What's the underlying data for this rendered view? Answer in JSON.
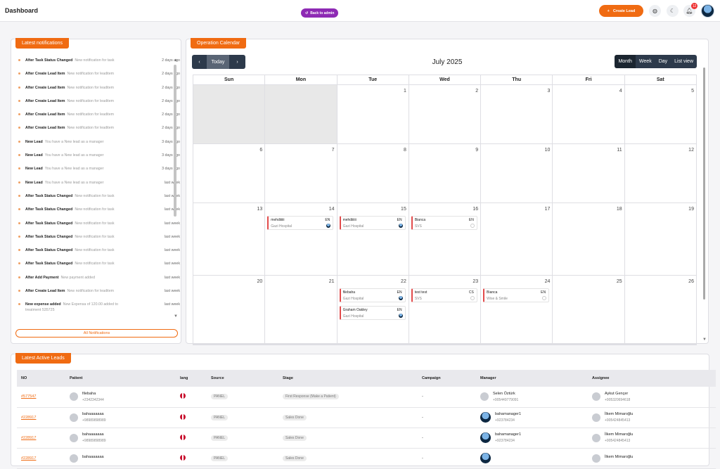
{
  "header": {
    "title": "Dashboard",
    "back_label": "Back to admin",
    "create_label": "Create Lead",
    "notification_count": "12"
  },
  "notifications": {
    "title": "Latest notifications",
    "items": [
      {
        "title": "After Task Status Changed",
        "text": "New notification for task",
        "time": "2 days ago"
      },
      {
        "title": "After Create Lead Item",
        "text": "New notification for leaditem",
        "time": "2 days ago"
      },
      {
        "title": "After Create Lead Item",
        "text": "New notification for leaditem",
        "time": "2 days ago"
      },
      {
        "title": "After Create Lead Item",
        "text": "New notification for leaditem",
        "time": "2 days ago"
      },
      {
        "title": "After Create Lead Item",
        "text": "New notification for leaditem",
        "time": "2 days ago"
      },
      {
        "title": "After Create Lead Item",
        "text": "New notification for leaditem",
        "time": "2 days ago"
      },
      {
        "title": "New Lead",
        "text": "You have a New lead as a manager",
        "time": "3 days ago"
      },
      {
        "title": "New Lead",
        "text": "You have a New lead as a manager",
        "time": "3 days ago"
      },
      {
        "title": "New Lead",
        "text": "You have a New lead as a manager",
        "time": "3 days ago"
      },
      {
        "title": "New Lead",
        "text": "You have a New lead as a manager",
        "time": "last week"
      },
      {
        "title": "After Task Status Changed",
        "text": "New notification for task",
        "time": "last week"
      },
      {
        "title": "After Task Status Changed",
        "text": "New notification for task",
        "time": "last week"
      },
      {
        "title": "After Task Status Changed",
        "text": "New notification for task",
        "time": "last week"
      },
      {
        "title": "After Task Status Changed",
        "text": "New notification for task",
        "time": "last week"
      },
      {
        "title": "After Task Status Changed",
        "text": "New notification for task",
        "time": "last week"
      },
      {
        "title": "After Task Status Changed",
        "text": "New notification for task",
        "time": "last week"
      },
      {
        "title": "After Add Payment",
        "text": "New payment added",
        "time": "last week"
      },
      {
        "title": "After Create Lead Item",
        "text": "New notification for leaditem",
        "time": "last week"
      },
      {
        "title": "New expense added",
        "text": "New Expensa of 120.00 added to",
        "text2": "treatment 535725",
        "time": "last week"
      }
    ],
    "all_label": "All Notifications"
  },
  "calendar": {
    "title": "Operation Calendar",
    "today": "Today",
    "prev": "‹",
    "next": "›",
    "month": "July 2025",
    "views": [
      "Month",
      "Week",
      "Day",
      "List view"
    ],
    "days": [
      "Sun",
      "Mon",
      "Tue",
      "Wed",
      "Thu",
      "Fri",
      "Sat"
    ],
    "weeks": [
      [
        "",
        "",
        "1",
        "2",
        "3",
        "4",
        "5"
      ],
      [
        "6",
        "7",
        "8",
        "9",
        "10",
        "11",
        "12"
      ],
      [
        "13",
        "14",
        "15",
        "16",
        "17",
        "18",
        "19"
      ],
      [
        "20",
        "21",
        "22",
        "23",
        "24",
        "25",
        "26"
      ]
    ],
    "events": {
      "w3": [
        {
          "day": 1,
          "name": "mehdiiiiii",
          "lang": "EN",
          "sub": "Gazi Hospital",
          "icon": "full"
        },
        {
          "day": 2,
          "name": "mehdiiiiii",
          "lang": "EN",
          "sub": "Gazi Hospital",
          "icon": "full"
        },
        {
          "day": 3,
          "name": "Bianca",
          "lang": "EN",
          "sub": "SVS",
          "icon": "empty"
        }
      ],
      "w4": [
        {
          "day": 2,
          "name": "filebaha",
          "lang": "EN",
          "sub": "Gazi Hospital",
          "icon": "full",
          "row": 0
        },
        {
          "day": 2,
          "name": "Graham Oakley",
          "lang": "EN",
          "sub": "Gazi Hospital",
          "icon": "full",
          "row": 1
        },
        {
          "day": 3,
          "name": "test test",
          "lang": "CS",
          "sub": "SVS",
          "icon": "empty",
          "row": 0
        },
        {
          "day": 4,
          "name": "Bianca",
          "lang": "EN",
          "sub": "Wise & Smile",
          "icon": "empty",
          "row": 0
        }
      ]
    }
  },
  "leads": {
    "title": "Latest Active Leads",
    "columns": [
      "NO",
      "Patient",
      "lang",
      "Source",
      "Stage",
      "Campaign",
      "Manager",
      "Assignee"
    ],
    "rows": [
      {
        "no": "#577547",
        "patient": "filebaha",
        "phone": "+2342342344",
        "source": "PANEL",
        "stage": "First Response (Make a Patient)",
        "campaign": "-",
        "manager": "Selen Öztürk",
        "mphone": "+905449779091",
        "mavatar": "grey",
        "assignee": "Aykut Gençer",
        "aphone": "+905320694618"
      },
      {
        "no": "#228917",
        "patient": "bahaaaaaaa",
        "phone": "+98989898989",
        "source": "PANEL",
        "stage": "Sales Done",
        "campaign": "-",
        "manager": "bahamanager1",
        "mphone": "+923784234",
        "mavatar": "blue",
        "assignee": "İlkem Mimaroğlu",
        "aphone": "+905424845413"
      },
      {
        "no": "#228917",
        "patient": "bahaaaaaaa",
        "phone": "+98989898989",
        "source": "PANEL",
        "stage": "Sales Done",
        "campaign": "-",
        "manager": "bahamanager1",
        "mphone": "+923784234",
        "mavatar": "blue",
        "assignee": "İlkem Mimaroğlu",
        "aphone": "+905424845413"
      },
      {
        "no": "#228917",
        "patient": "bahaaaaaaa",
        "phone": "",
        "source": "PANEL",
        "stage": "Sales Done",
        "campaign": "-",
        "manager": "",
        "mphone": "",
        "mavatar": "blue",
        "assignee": "İlkem Mimaroğlu",
        "aphone": ""
      }
    ]
  }
}
